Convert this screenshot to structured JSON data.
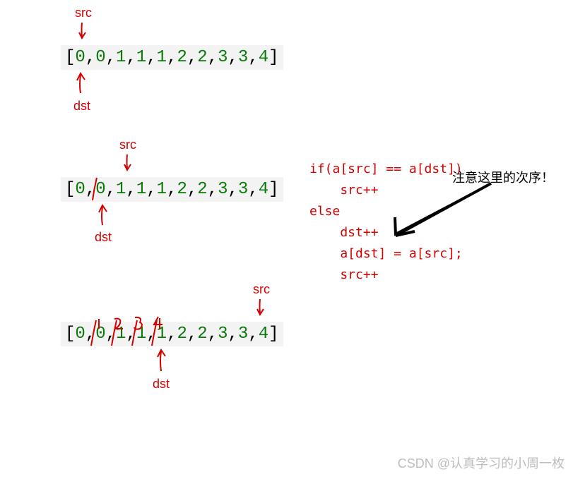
{
  "labels": {
    "src": "src",
    "dst": "dst"
  },
  "arrays": {
    "step1": {
      "raw": "[0,0,1,1,1,2,2,3,3,4]",
      "src_index": 0,
      "dst_index": 0
    },
    "step2": {
      "raw": "[0,0,1,1,1,2,2,3,3,4]",
      "src_index": 2,
      "dst_index": 1,
      "overwrite_at_index": 1
    },
    "step3": {
      "raw": "[0,0,1,1,1,2,2,3,3,4]",
      "src_index": 9,
      "dst_index": 4,
      "overwritten": [
        1,
        2,
        3,
        4
      ]
    }
  },
  "code": {
    "l1": "if(a[src] == a[dst])",
    "l2": "    src++",
    "l3": "else",
    "l4": "    dst++",
    "l5": "    a[dst] = a[src];",
    "l6": "    src++"
  },
  "note": "注意这里的次序！",
  "watermark": "CSDN @认真学习的小周一枚"
}
